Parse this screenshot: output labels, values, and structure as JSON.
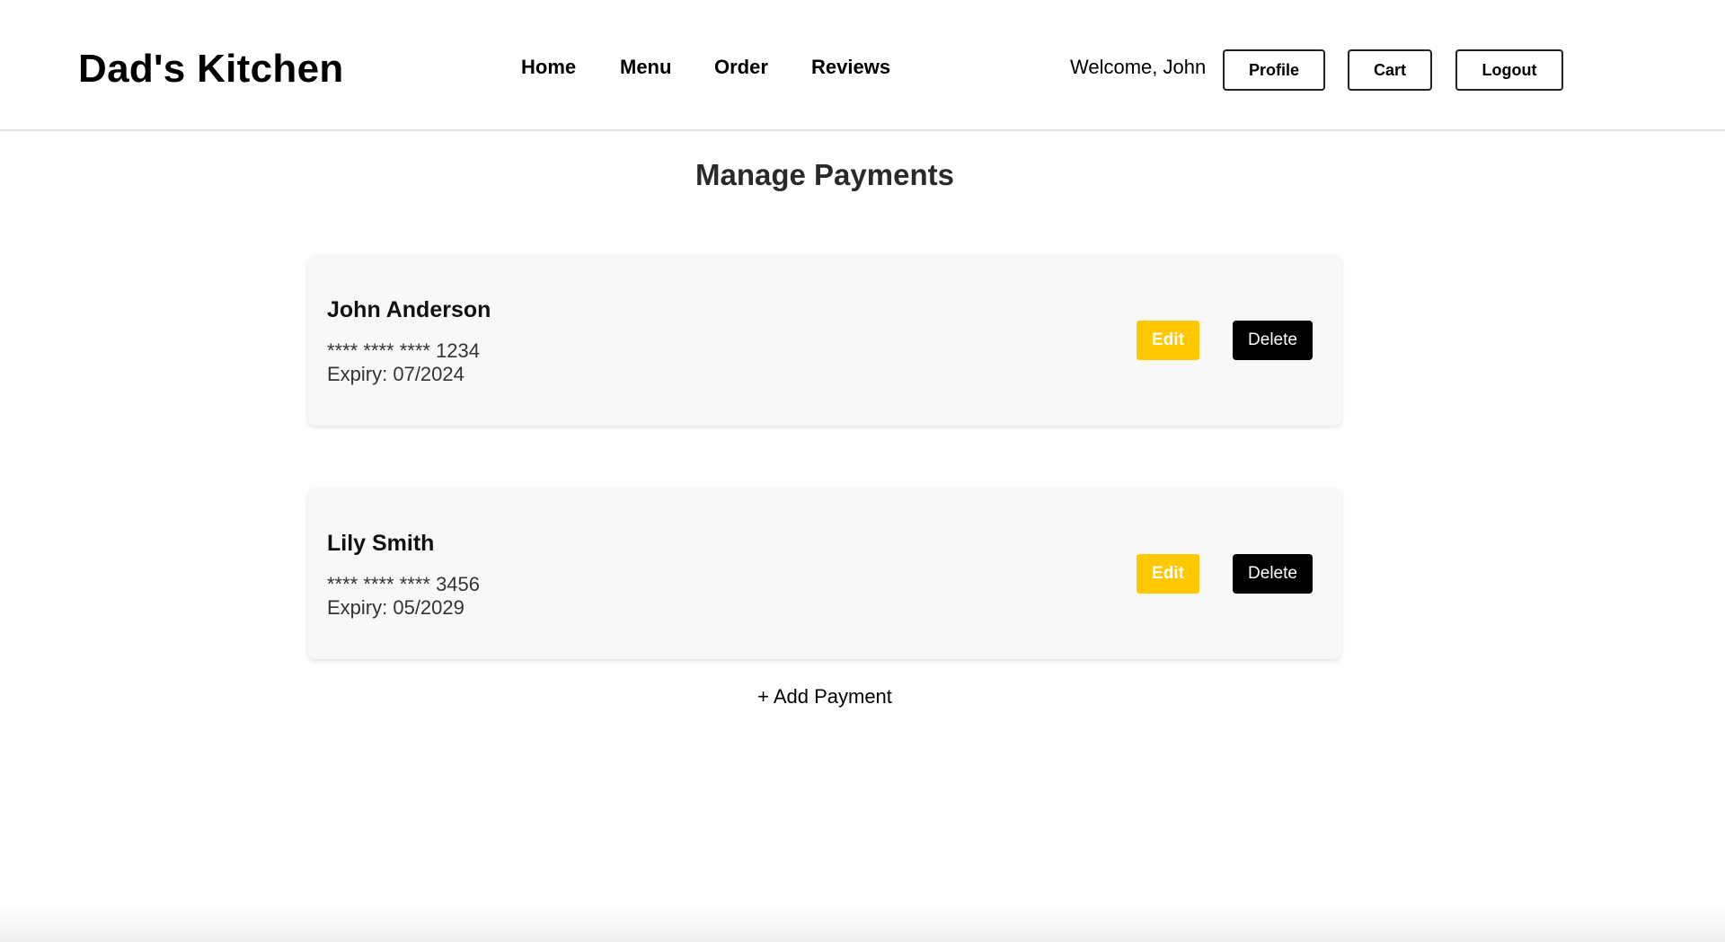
{
  "header": {
    "logo": "Dad's Kitchen",
    "nav": [
      {
        "label": "Home"
      },
      {
        "label": "Menu"
      },
      {
        "label": "Order"
      },
      {
        "label": "Reviews"
      }
    ],
    "welcome": "Welcome, John",
    "buttons": {
      "profile": "Profile",
      "cart": "Cart",
      "logout": "Logout"
    }
  },
  "main": {
    "title": "Manage Payments",
    "payments": [
      {
        "name": "John Anderson",
        "number": "**** **** **** 1234",
        "expiry": "Expiry: 07/2024",
        "edit_label": "Edit",
        "delete_label": "Delete"
      },
      {
        "name": "Lily Smith",
        "number": "**** **** **** 3456",
        "expiry": "Expiry: 05/2029",
        "edit_label": "Edit",
        "delete_label": "Delete"
      }
    ],
    "add_payment": "+ Add Payment"
  },
  "colors": {
    "edit_button": "#ffc800",
    "delete_button": "#000000",
    "card_background": "#f8f8f8"
  }
}
